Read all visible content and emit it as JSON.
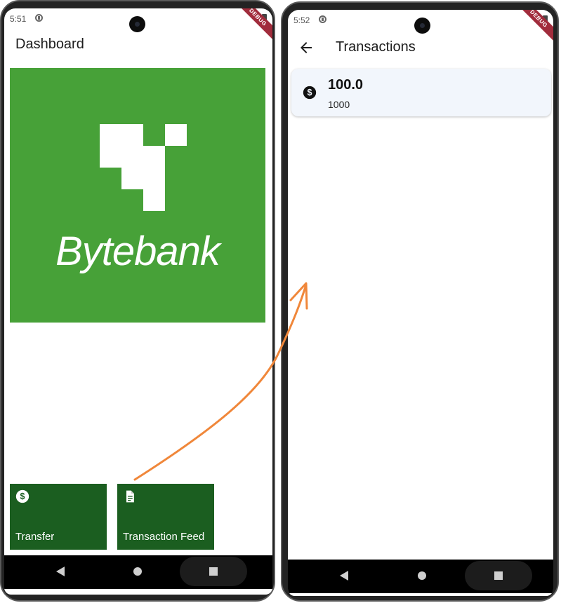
{
  "left_screen": {
    "status_time": "5:51",
    "debug_label": "DEBUG",
    "title": "Dashboard",
    "logo_text": "Bytebank",
    "tiles": [
      {
        "label": "Transfer",
        "icon": "monetization-icon"
      },
      {
        "label": "Transaction Feed",
        "icon": "description-icon"
      }
    ]
  },
  "right_screen": {
    "status_time": "5:52",
    "debug_label": "DEBUG",
    "title": "Transactions",
    "transactions": [
      {
        "value": "100.0",
        "account": "1000",
        "icon": "monetization-icon"
      }
    ]
  },
  "colors": {
    "logo_green": "#47a138",
    "tile_green": "#1b5e20",
    "card_background": "#f2f6fc",
    "annotation_arrow": "#f0873a"
  }
}
